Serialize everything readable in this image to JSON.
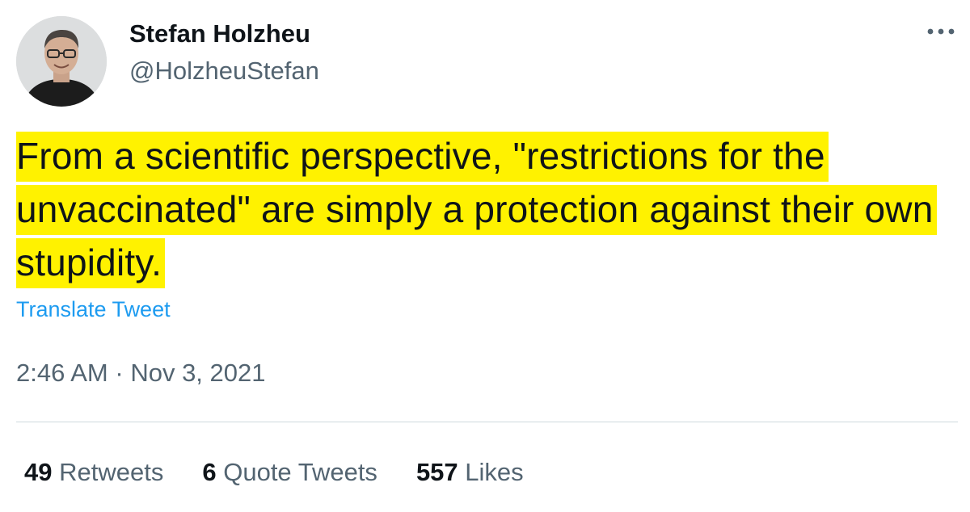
{
  "author": {
    "display_name": "Stefan Holzheu",
    "handle": "@HolzheuStefan",
    "avatar_icon": "profile-photo"
  },
  "more_icon": "more-horizontal-icon",
  "tweet": {
    "text": "From a scientific perspective, \"restrictions for the unvaccinated\" are simply a protection against their own stupidity.",
    "highlight_color": "#fff200",
    "translate_label": "Translate Tweet",
    "time": "2:46 AM",
    "separator": "·",
    "date": "Nov 3, 2021"
  },
  "stats": {
    "retweets": {
      "count": "49",
      "label": "Retweets"
    },
    "quotes": {
      "count": "6",
      "label": "Quote Tweets"
    },
    "likes": {
      "count": "557",
      "label": "Likes"
    }
  },
  "colors": {
    "text": "#0f1419",
    "secondary": "#536471",
    "link": "#1d9bf0",
    "divider": "#cfd9de"
  }
}
